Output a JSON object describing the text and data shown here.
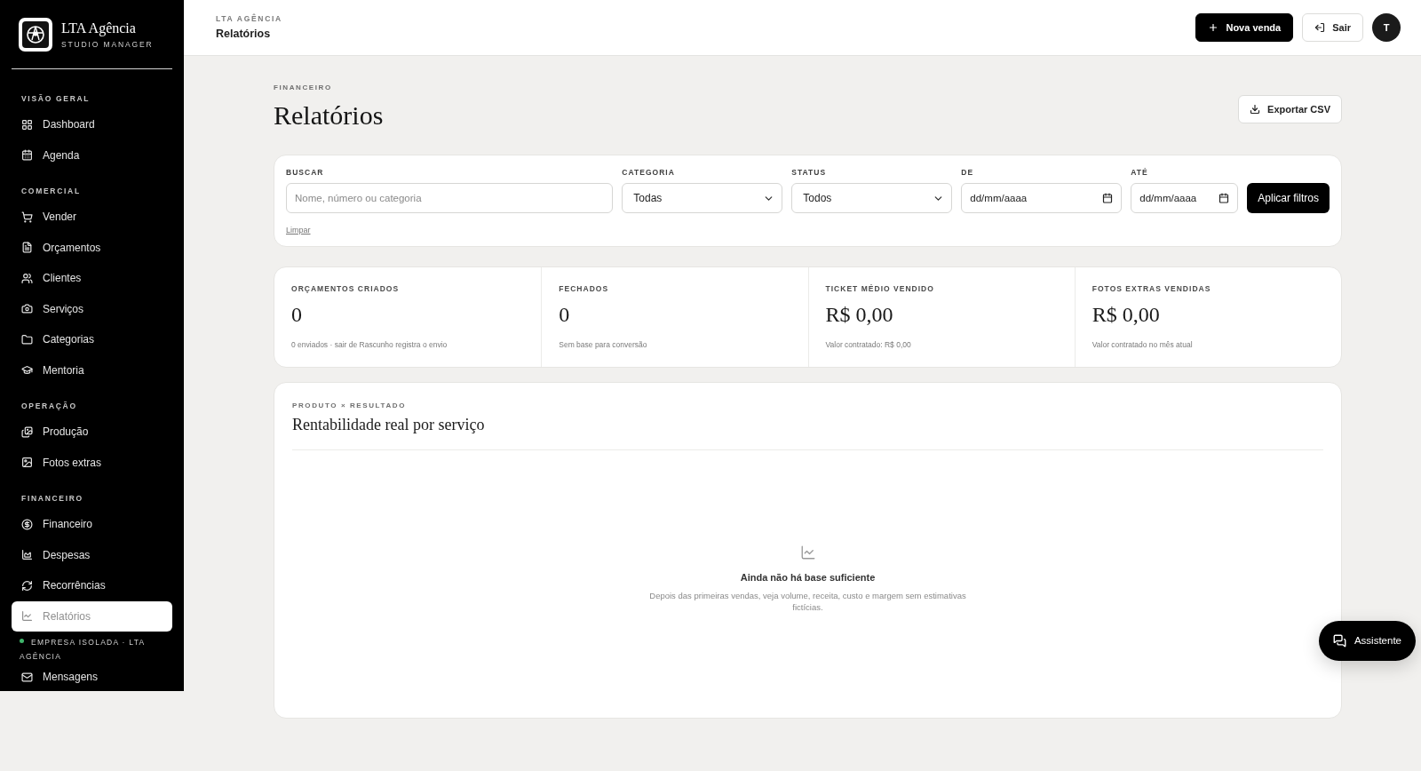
{
  "sidebar": {
    "brand": {
      "name": "LTA Agência",
      "tagline": "STUDIO MANAGER"
    },
    "sections": [
      {
        "title": "VISÃO GERAL",
        "items": [
          {
            "label": "Dashboard",
            "selected": false
          },
          {
            "label": "Agenda",
            "selected": false
          }
        ]
      },
      {
        "title": "COMERCIAL",
        "items": [
          {
            "label": "Vender",
            "selected": false
          },
          {
            "label": "Orçamentos",
            "selected": false
          },
          {
            "label": "Clientes",
            "selected": false
          },
          {
            "label": "Serviços",
            "selected": false
          },
          {
            "label": "Categorias",
            "selected": false
          },
          {
            "label": "Mentoria",
            "selected": false
          }
        ]
      },
      {
        "title": "OPERAÇÃO",
        "items": [
          {
            "label": "Produção",
            "selected": false
          },
          {
            "label": "Fotos extras",
            "selected": false
          }
        ]
      },
      {
        "title": "FINANCEIRO",
        "items": [
          {
            "label": "Financeiro",
            "selected": false
          },
          {
            "label": "Despesas",
            "selected": false
          },
          {
            "label": "Recorrências",
            "selected": false
          },
          {
            "label": "Relatórios",
            "selected": true
          }
        ]
      }
    ],
    "footer": {
      "text": "EMPRESA ISOLADA · LTA AGÊNCIA",
      "color": "#3fb56b"
    },
    "after_footer": [
      {
        "label": "Mensagens",
        "selected": false
      }
    ]
  },
  "header": {
    "breadcrumb": "LTA AGÊNCIA",
    "title": "Relatórios",
    "buttons": [
      {
        "label": "Nova venda",
        "kind": "primary"
      },
      {
        "label": "Sair",
        "kind": "secondary"
      }
    ],
    "avatar": "T"
  },
  "page": {
    "eyebrow": "FINANCEIRO",
    "title": "Relatórios",
    "export_button": "Exportar CSV"
  },
  "filters": {
    "fields": [
      {
        "kind": "text",
        "label": "BUSCAR",
        "placeholder": "Nome, número ou categoria"
      },
      {
        "kind": "select",
        "label": "CATEGORIA",
        "value": "Todas"
      },
      {
        "kind": "select",
        "label": "STATUS",
        "value": "Todos"
      },
      {
        "kind": "date",
        "label": "DE",
        "placeholder": "dd/mm/aaaa"
      },
      {
        "kind": "date",
        "label": "ATÉ",
        "placeholder": "dd/mm/aaaa"
      }
    ],
    "apply_button": "Aplicar filtros",
    "clear_link": "Limpar"
  },
  "stats": [
    {
      "label": "ORÇAMENTOS CRIADOS",
      "value": "0",
      "note": "0 enviados · sair de Rascunho registra o envio"
    },
    {
      "label": "FECHADOS",
      "value": "0",
      "note": "Sem base para conversão"
    },
    {
      "label": "TICKET MÉDIO VENDIDO",
      "value": "R$ 0,00",
      "note": "Valor contratado: R$ 0,00"
    },
    {
      "label": "FOTOS EXTRAS VENDIDAS",
      "value": "R$ 0,00",
      "note": "Valor contratado no mês atual"
    }
  ],
  "report": {
    "eyebrow": "PRODUTO × RESULTADO",
    "title": "Rentabilidade real por serviço",
    "empty_state": {
      "title": "Ainda não há base suficiente",
      "text": "Depois das primeiras vendas, veja volume, receita, custo e margem sem estimativas fictícias."
    }
  },
  "assistant_button": "Assistente"
}
